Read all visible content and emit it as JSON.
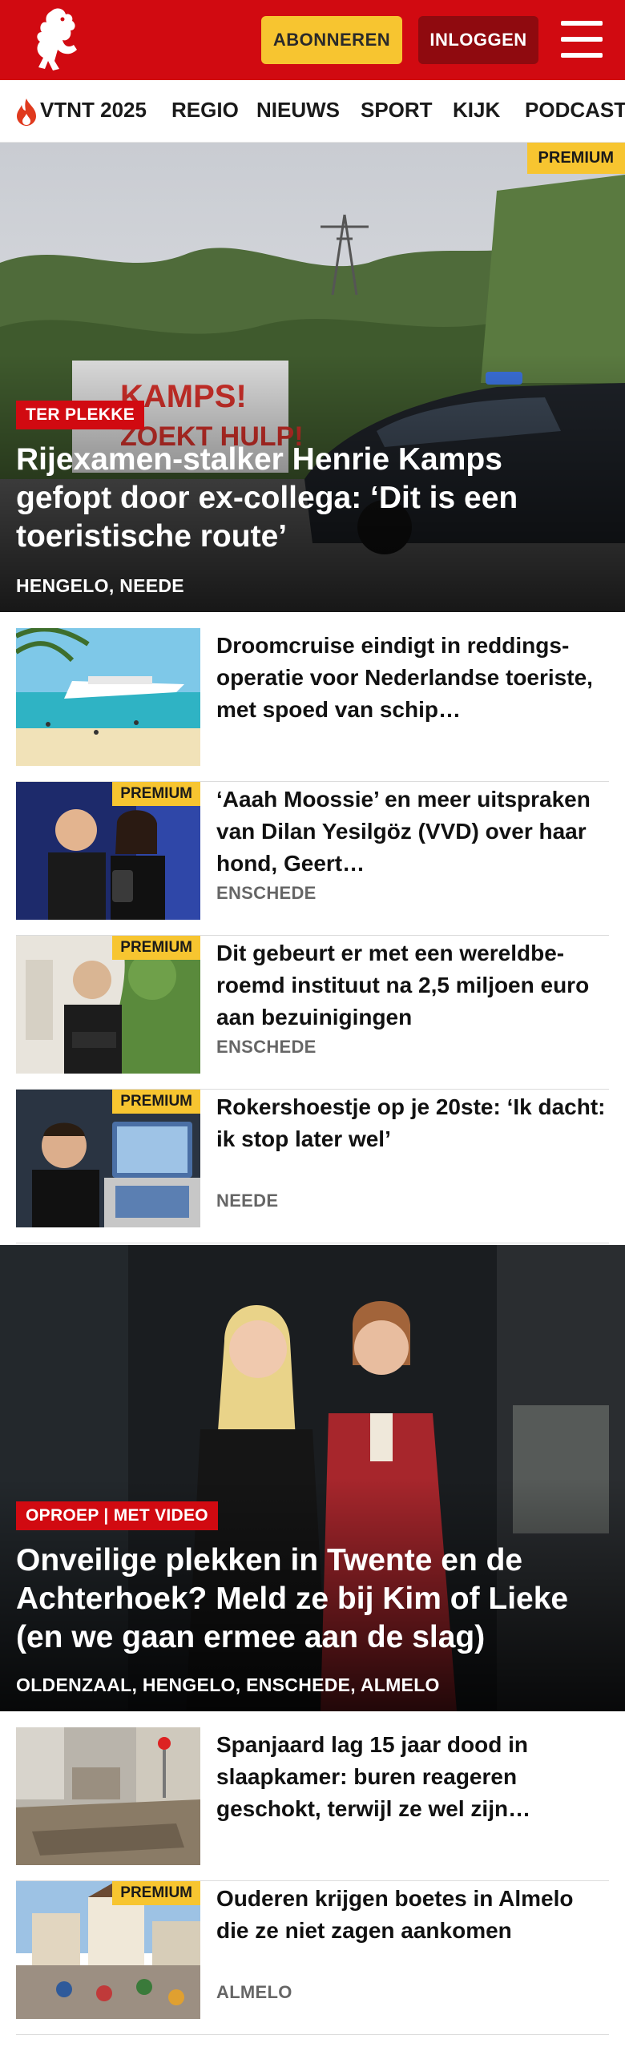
{
  "header": {
    "subscribe_label": "ABONNEREN",
    "login_label": "INLOGGEN",
    "colors": {
      "brand": "#d10a11",
      "accent": "#f7c530"
    }
  },
  "nav": {
    "items": [
      "VTNT 2025",
      "REGIO",
      "NIEUWS",
      "SPORT",
      "KIJK",
      "PODCAST"
    ]
  },
  "hero1": {
    "premium_label": "PREMIUM",
    "tag": "TER PLEKKE",
    "title": "Rijexamen-stalker Henrie Kamps gefopt door ex-collega: ‘Dit is een toeristische route’",
    "location": "HENGELO, NEEDE",
    "graffiti": "KAMPS! ZOEKT HULP!"
  },
  "list1": [
    {
      "title": "Droomcruise eindigt in reddings-operatie voor Nederlandse toeriste, met spoed van schip…",
      "location": "",
      "premium": ""
    },
    {
      "title": "‘Aaah Moossie’ en meer uitspraken van Dilan Yesilgöz (VVD) over haar hond, Geert…",
      "location": "ENSCHEDE",
      "premium": "PREMIUM"
    },
    {
      "title": "Dit gebeurt er met een wereldbe-roemd instituut na 2,5 miljoen euro aan bezuinigingen",
      "location": "ENSCHEDE",
      "premium": "PREMIUM"
    },
    {
      "title": "Rokershoestje op je 20ste: ‘Ik dacht: ik stop later wel’",
      "location": "NEEDE",
      "premium": "PREMIUM"
    }
  ],
  "hero2": {
    "tag": "OPROEP | MET VIDEO",
    "title": "Onveilige plekken in Twente en de Achterhoek? Meld ze bij Kim of Lieke (en we gaan ermee aan de slag)",
    "location": "OLDENZAAL, HENGELO, ENSCHEDE, ALMELO"
  },
  "list2": [
    {
      "title": "Spanjaard lag 15 jaar dood in slaapkamer: buren reageren geschokt, terwijl ze wel zijn…",
      "location": "",
      "premium": ""
    },
    {
      "title": "Ouderen krijgen boetes in Almelo die ze niet zagen aankomen",
      "location": "ALMELO",
      "premium": "PREMIUM"
    }
  ]
}
